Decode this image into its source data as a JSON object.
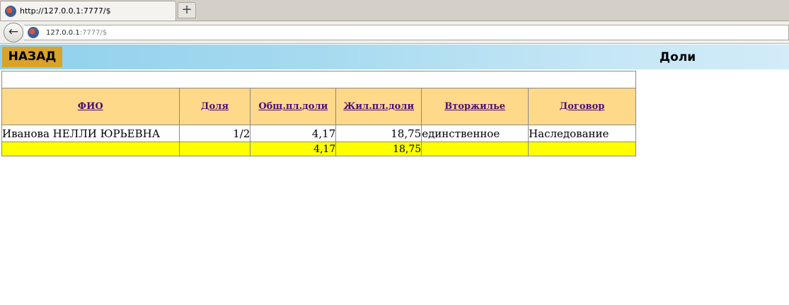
{
  "browser": {
    "tab_title": "http://127.0.0.1:7777/$",
    "new_tab_label": "+",
    "back_label": "←",
    "url_host": "127.0.0.1",
    "url_rest": ":7777/$"
  },
  "header": {
    "back_button": "НАЗАД",
    "title": "Доли"
  },
  "table": {
    "columns": [
      "ФИО",
      "Доля",
      "Общ.пл.доли",
      "Жил.пл.доли",
      "Вторжилье",
      "Договор"
    ],
    "rows": [
      [
        "Иванова НЕЛЛИ ЮРЬЕВНА",
        "1/2",
        "4,17",
        "18,75",
        "единственное",
        "Наследование"
      ]
    ],
    "totals": [
      "",
      "",
      "4,17",
      "18,75",
      "",
      ""
    ]
  },
  "colors": {
    "header_bar": "#a6daf0",
    "back_button": "#d9a22a",
    "column_header": "#ffd98a",
    "totals_row": "#ffff00",
    "link": "#4b0c7a"
  }
}
